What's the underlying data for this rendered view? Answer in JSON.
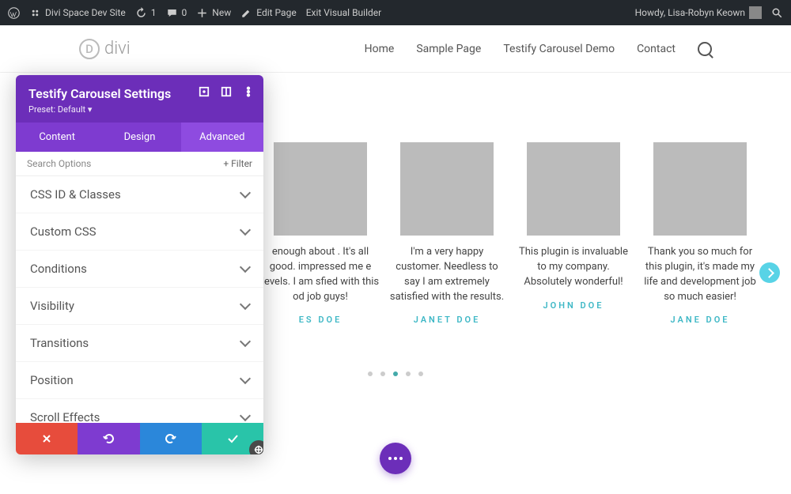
{
  "wpbar": {
    "site": "Divi Space Dev Site",
    "updates": "1",
    "comments": "0",
    "new": "New",
    "edit": "Edit Page",
    "exit": "Exit Visual Builder",
    "howdy": "Howdy, Lisa-Robyn Keown"
  },
  "header": {
    "logo_text": "divi",
    "nav": [
      "Home",
      "Sample Page",
      "Testify Carousel Demo",
      "Contact"
    ]
  },
  "panel": {
    "title": "Testify Carousel Settings",
    "preset": "Preset: Default ▾",
    "tabs": [
      "Content",
      "Design",
      "Advanced"
    ],
    "active_tab": 2,
    "search_placeholder": "Search Options",
    "filter_label": "Filter",
    "sections": [
      "CSS ID & Classes",
      "Custom CSS",
      "Conditions",
      "Visibility",
      "Transitions",
      "Position",
      "Scroll Effects"
    ]
  },
  "carousel": {
    "cards": [
      {
        "text": "enough about . It's all good. impressed me e levels. I am sfied with this od job guys!",
        "author": "ES DOE"
      },
      {
        "text": "I'm a very happy customer. Needless to say I am extremely satisfied with the results.",
        "author": "JANET DOE"
      },
      {
        "text": "This plugin is invaluable to my company. Absolutely wonderful!",
        "author": "JOHN DOE"
      },
      {
        "text": "Thank you so much for this plugin, it's made my life and development job so much easier!",
        "author": "JANE DOE"
      }
    ],
    "dot_count": 5,
    "active_dot": 2
  }
}
